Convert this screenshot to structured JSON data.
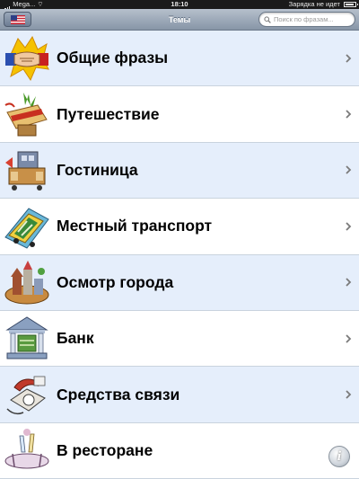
{
  "status": {
    "carrier": "Mega...",
    "time": "18:10",
    "battery_text": "Зарядка не идет",
    "battery_level": 0.85
  },
  "nav": {
    "title": "Темы",
    "flag_icon": "us-flag-icon",
    "search_placeholder": "Поиск по фразам..."
  },
  "topics": [
    {
      "label": "Общие фразы",
      "icon": "handshake-icon"
    },
    {
      "label": "Путешествие",
      "icon": "luggage-icon"
    },
    {
      "label": "Гостиница",
      "icon": "hotel-icon"
    },
    {
      "label": "Местный транспорт",
      "icon": "train-icon"
    },
    {
      "label": "Осмотр города",
      "icon": "city-icon"
    },
    {
      "label": "Банк",
      "icon": "bank-icon"
    },
    {
      "label": "Средства связи",
      "icon": "telephone-icon"
    },
    {
      "label": "В ресторане",
      "icon": "restaurant-icon"
    }
  ],
  "colors": {
    "row_alt": "#e5eefb",
    "row_plain": "#ffffff",
    "nav_gradient_top": "#b6c0cc",
    "nav_gradient_bottom": "#8795a7"
  }
}
